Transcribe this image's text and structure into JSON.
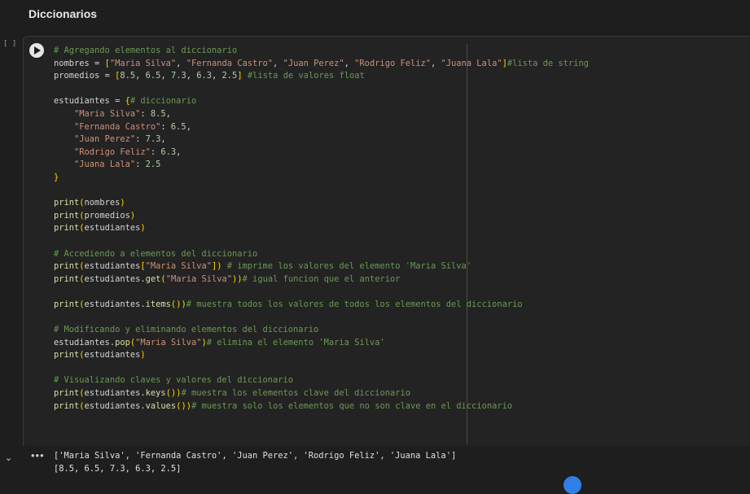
{
  "section": {
    "title": "Diccionarios"
  },
  "cell": {
    "execution_count": "[ ]",
    "run_icon": "play-icon",
    "code_lines": [
      "# Agregando elementos al diccionario",
      "nombres = [\"Maria Silva\", \"Fernanda Castro\", \"Juan Perez\", \"Rodrigo Feliz\", \"Juana Lala\"]#lista de string",
      "promedios = [8.5, 6.5, 7.3, 6.3, 2.5] #lista de valores float",
      "",
      "estudiantes = {# diccionario",
      "    \"Maria Silva\": 8.5,",
      "    \"Fernanda Castro\": 6.5,",
      "    \"Juan Perez\": 7.3,",
      "    \"Rodrigo Feliz\": 6.3,",
      "    \"Juana Lala\": 2.5",
      "}",
      "",
      "print(nombres)",
      "print(promedios)",
      "print(estudiantes)",
      "",
      "# Accediendo a elementos del diccionario",
      "print(estudiantes[\"Maria Silva\"]) # imprime los valores del elemento 'Maria Silva'",
      "print(estudiantes.get(\"Maria Silva\"))# igual funcion que el anterior",
      "",
      "print(estudiantes.items())# muestra todos los valores de todos los elementos del diccionario",
      "",
      "# Modificando y eliminando elementos del diccionario",
      "estudiantes.pop(\"Maria Silva\")# elimina el elemento 'Maria Silva'",
      "print(estudiantes)",
      "",
      "# Visualizando claves y valores del diccionario",
      "print(estudiantes.keys())# muestra los elementos clave del diccionario",
      "print(estudiantes.values())# muestra solo los elementos que no son clave en el diccionario"
    ]
  },
  "output": {
    "collapse_icon": "chevron-down-icon",
    "more_label": "•••",
    "lines": [
      "['Maria Silva', 'Fernanda Castro', 'Juan Perez', 'Rodrigo Feliz', 'Juana Lala']",
      "[8.5, 6.5, 7.3, 6.3, 2.5]"
    ]
  },
  "colors": {
    "comment": "#6a9955",
    "string": "#ce9178",
    "number": "#b5cea8",
    "function": "#dcdcaa",
    "bracket": "#ffd700",
    "background": "#1e1e1e"
  }
}
